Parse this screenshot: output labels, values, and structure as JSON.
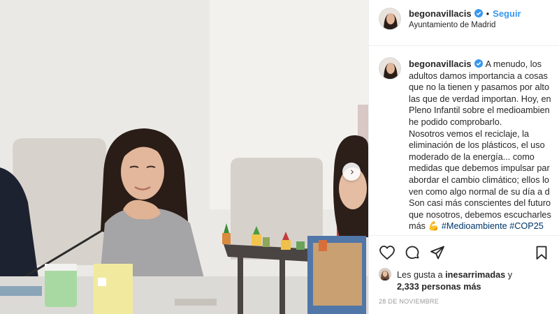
{
  "post": {
    "username": "begonavillacis",
    "separator": "•",
    "follow_label": "Seguir",
    "location": "Ayuntamiento de Madrid",
    "caption_lines": [
      "A menudo, los",
      "adultos damos importancia a cosas",
      "que no la tienen y pasamos por alto",
      "las que de verdad importan. Hoy, en",
      "Pleno Infantil sobre el medioambien",
      "he podido comprobarlo.",
      "Nosotros vemos el reciclaje, la",
      "eliminación de los plásticos, el uso",
      "moderado de la energía... como",
      "medidas que debemos impulsar par",
      "abordar el cambio climático; ellos lo",
      "ven como algo normal de su día a d",
      "Son casi más conscientes del futuro",
      "que nosotros, debemos escucharles"
    ],
    "caption_last_prefix": "más",
    "caption_emoji": "💪",
    "hashtags": [
      "#Medioambiente",
      "#COP25"
    ],
    "likes_prefix": "Les gusta a",
    "likes_user": "inesarrimadas",
    "likes_and": "y",
    "likes_count": "2,333 personas más",
    "date": "28 DE NOVIEMBRE"
  },
  "icons": {
    "verified": "verified-badge-icon",
    "like": "heart-icon",
    "comment": "comment-icon",
    "share": "share-icon",
    "save": "bookmark-icon",
    "next": "chevron-right-icon"
  },
  "carousel_next_glyph": "›",
  "colors": {
    "link_blue": "#3897f0",
    "hashtag": "#003569",
    "border": "#efefef",
    "muted": "#999999"
  }
}
